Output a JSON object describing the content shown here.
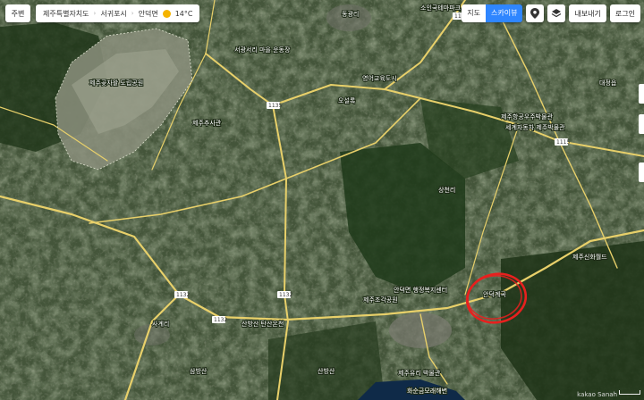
{
  "topbar": {
    "home_label": "주변",
    "region": "제주특별자치도",
    "city": "서귀포시",
    "district": "안덕면",
    "temperature": "14°C"
  },
  "tools": {
    "map_type_normal": "지도",
    "map_type_satellite": "스카이뷰",
    "share_label": "내보내기",
    "login_label": "로그인"
  },
  "routes": [
    "1135",
    "1135",
    "1115",
    "1132",
    "1132",
    "1132"
  ],
  "place_labels": [
    "제주곶자왈 도립공원",
    "서광서리 마을 운동장",
    "오설록",
    "제주항공우주박물관",
    "세계자동차 제주박물관",
    "제주추사관",
    "안덕면 행정복지센터",
    "제주조각공원",
    "산방산 탄산온천",
    "산방산",
    "화순금모래해변",
    "제주유리 박물관",
    "사계리",
    "제주신화월드",
    "소인국테마파크",
    "동광리",
    "영어교육도시",
    "삼방산",
    "대정읍",
    "상천리"
  ],
  "annotation_label": "안덕계곡",
  "footer": {
    "copyright": "kakao Sanah",
    "scale": "1km"
  },
  "colors": {
    "road": "#e8d06a",
    "accent": "#2f86ff",
    "circle": "#e8201e"
  }
}
